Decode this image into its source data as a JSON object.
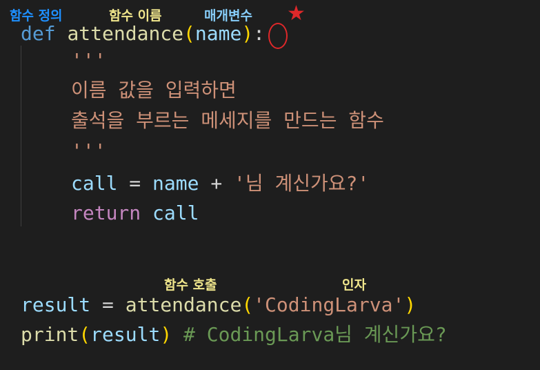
{
  "annotations": {
    "func_def": "함수 정의",
    "func_name": "함수 이름",
    "param": "매개변수",
    "func_call": "함수 호출",
    "arg": "인자"
  },
  "colors": {
    "background": "#1e1e1e",
    "annotation_blue": "#1e90ff",
    "annotation_yellow": "#f0e68c",
    "annotation_lightblue": "#87cefa",
    "marker_red": "#e0282a"
  },
  "code": {
    "line1": {
      "def": "def",
      "fname": "attendance",
      "open": "(",
      "param": "name",
      "close": ")",
      "colon": ":"
    },
    "line2": {
      "doc_open": "'''"
    },
    "line3": {
      "doc_text": "이름 값을 입력하면"
    },
    "line4": {
      "doc_text": "출석을 부르는 메세지를 만드는 함수"
    },
    "line5": {
      "doc_close": "'''"
    },
    "line6": {
      "var": "call",
      "eq": "=",
      "name": "name",
      "plus": "+",
      "str": "'님 계신가요?'"
    },
    "line7": {
      "ret": "return",
      "var": "call"
    },
    "line8": {
      "var": "result",
      "eq": "=",
      "fname": "attendance",
      "open": "(",
      "arg": "'CodingLarva'",
      "close": ")"
    },
    "line9": {
      "fname": "print",
      "open": "(",
      "arg": "result",
      "close": ")",
      "comment": "# CodingLarva님 계신가요?"
    }
  }
}
